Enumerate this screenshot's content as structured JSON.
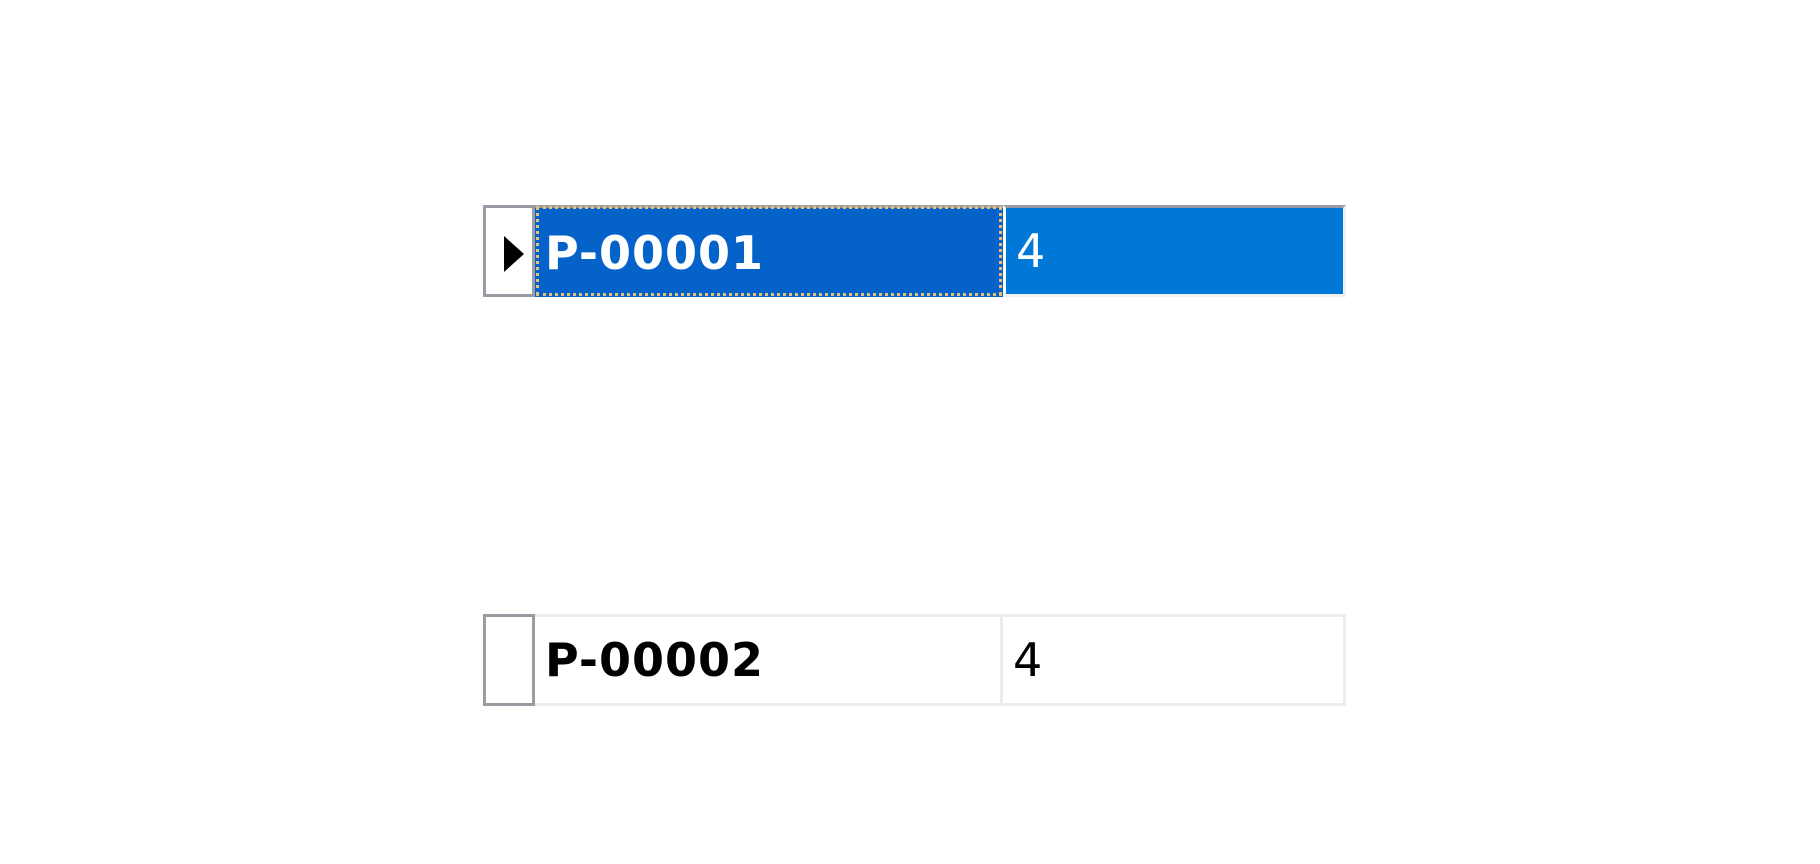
{
  "grid": {
    "rows": [
      {
        "id": "P-00001",
        "value": "4",
        "selected": true
      },
      {
        "id": "P-00002",
        "value": "4",
        "selected": false
      }
    ]
  },
  "colors": {
    "selected_id_cell": "#0562c8",
    "selected_value_cell": "#0078d7",
    "selected_text": "#ffffff",
    "focus_outline": "#e6c079",
    "row_header_border": "#9a9ca3",
    "grid_line": "#ececec"
  },
  "icons": {
    "row_indicator": "current-row-arrow-icon"
  }
}
